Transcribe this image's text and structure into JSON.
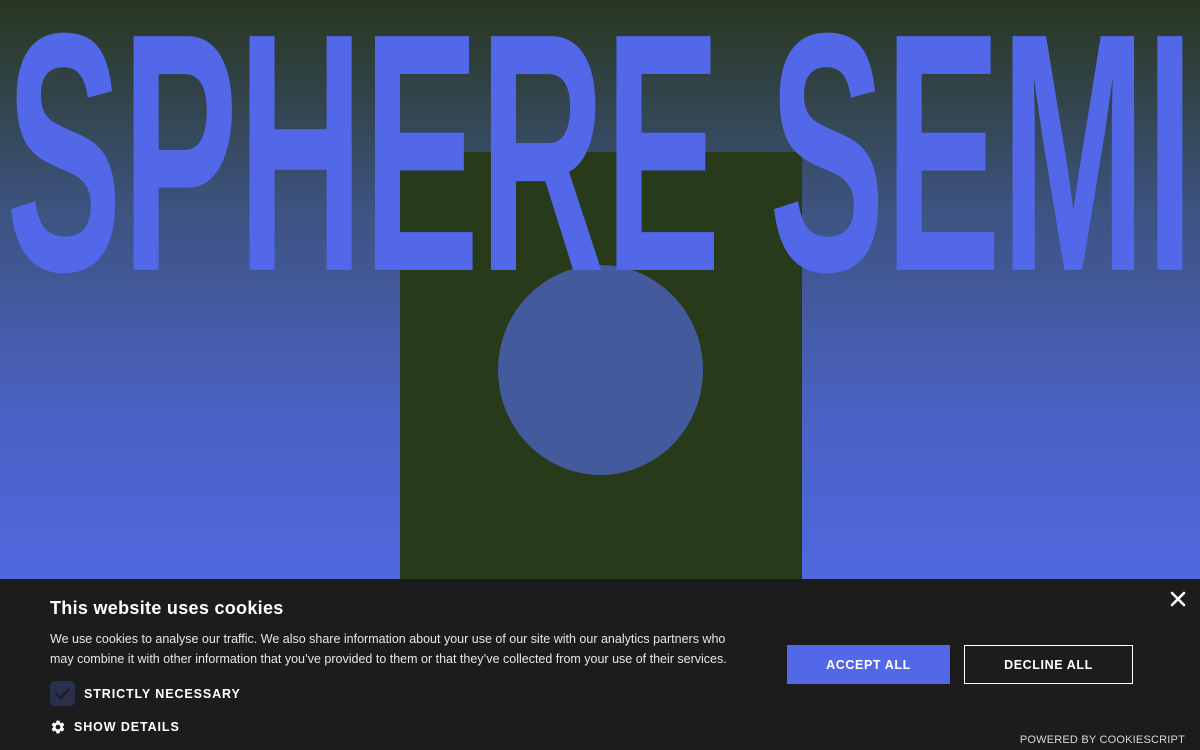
{
  "hero": {
    "title": "SPHERE SEMI"
  },
  "cookie_banner": {
    "title": "This website uses cookies",
    "description": "We use cookies to analyse our traffic. We also share information about your use of our site with our analytics partners who may combine it with other information that you’ve provided to them or that they’ve collected from your use of their services.",
    "strictly_necessary_label": "STRICTLY NECESSARY",
    "strictly_necessary_checked": true,
    "show_details_label": "SHOW DETAILS",
    "accept_label": "ACCEPT ALL",
    "decline_label": "DECLINE ALL",
    "powered_by": "POWERED BY COOKIESCRIPT",
    "icons": {
      "checkbox": "checkmark-icon",
      "details": "gear-icon",
      "close": "close-icon"
    }
  },
  "colors": {
    "brand_blue": "#5368e8",
    "dark_green": "#273a19",
    "banner_bg": "#1c1c1c",
    "circle": "#435a9c"
  }
}
